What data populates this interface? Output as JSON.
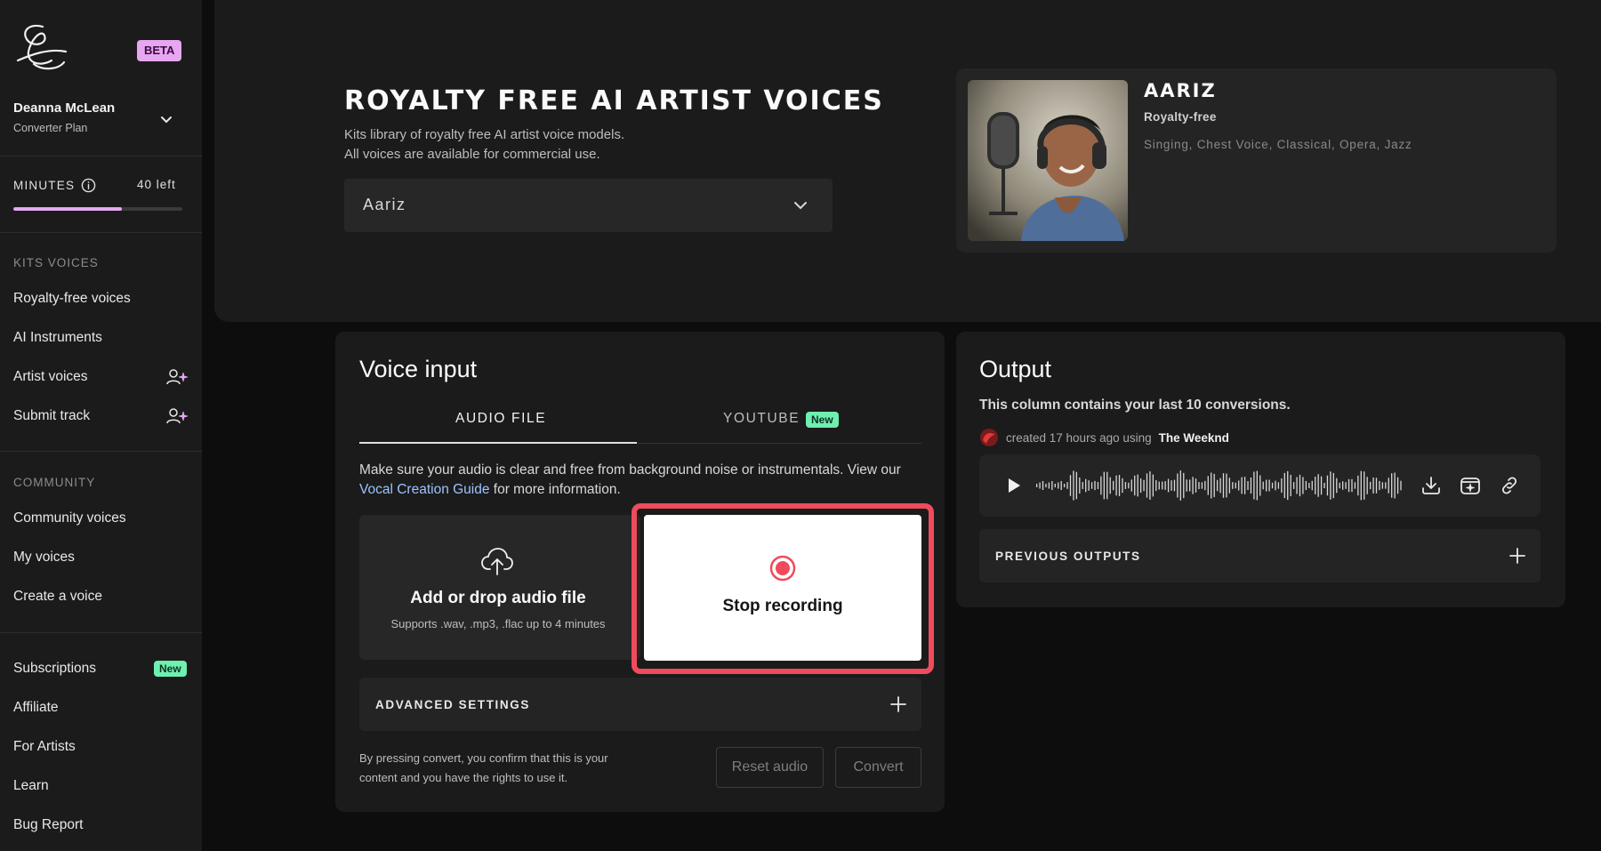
{
  "sidebar": {
    "beta_badge": "BETA",
    "user": {
      "name": "Deanna McLean",
      "plan": "Converter Plan"
    },
    "minutes": {
      "label": "MINUTES",
      "left": "40 left",
      "used_fraction": 0.64
    },
    "kits_voices": {
      "heading": "KITS VOICES",
      "items": [
        {
          "label": "Royalty-free voices",
          "icon": ""
        },
        {
          "label": "AI Instruments",
          "icon": ""
        },
        {
          "label": "Artist voices",
          "icon": "user-sparkle-icon"
        },
        {
          "label": "Submit track",
          "icon": "user-sparkle-icon"
        }
      ]
    },
    "community": {
      "heading": "COMMUNITY",
      "items": [
        {
          "label": "Community voices"
        },
        {
          "label": "My voices"
        },
        {
          "label": "Create a voice"
        }
      ]
    },
    "footer_items": [
      {
        "label": "Subscriptions",
        "badge": "New"
      },
      {
        "label": "Affiliate"
      },
      {
        "label": "For Artists"
      },
      {
        "label": "Learn"
      },
      {
        "label": "Bug Report"
      }
    ]
  },
  "header": {
    "title": "ROYALTY FREE AI ARTIST VOICES",
    "subtitle_line1": "Kits library of royalty free AI artist voice models.",
    "subtitle_line2": "All voices are available for commercial use.",
    "voice_select": {
      "value": "Aariz"
    },
    "artist": {
      "name": "AARIZ",
      "tag": "Royalty-free",
      "genres": "Singing, Chest Voice, Classical, Opera, Jazz"
    }
  },
  "voice_input": {
    "title": "Voice input",
    "tabs": [
      {
        "label": "AUDIO FILE",
        "active": true
      },
      {
        "label": "YOUTUBE",
        "badge": "New"
      }
    ],
    "help_text": "Make sure your audio is clear and free from background noise or instrumentals. View our ",
    "help_link": "Vocal Creation Guide",
    "help_text_after": " for more information.",
    "drop": {
      "title": "Add or drop audio file",
      "subtitle": "Supports .wav, .mp3, .flac up to 4 minutes"
    },
    "record": {
      "label": "Stop recording"
    },
    "advanced_settings": "ADVANCED SETTINGS",
    "disclaimer": "By pressing convert, you confirm that this is your content and you have the rights to use it.",
    "reset_button": "Reset audio",
    "convert_button": "Convert"
  },
  "output": {
    "title": "Output",
    "subtitle": "This column contains your last 10 conversions.",
    "created_prefix": "created 17 hours ago using",
    "created_artist": "The Weeknd",
    "previous_outputs": "PREVIOUS OUTPUTS"
  },
  "colors": {
    "accent_purple": "#e2a9f0",
    "new_badge": "#6ef0b0",
    "record_red": "#ef4b5c",
    "link_blue": "#9bc3ff"
  }
}
